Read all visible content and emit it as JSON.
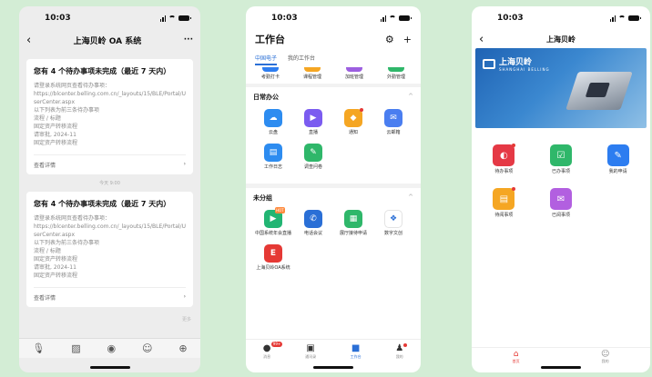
{
  "status": {
    "time": "10:03"
  },
  "chat": {
    "title": "上海贝岭 OA 系统",
    "more": "···",
    "messages": [
      {
        "title": "您有 4 个待办事项未完成（最近 7 天内）",
        "lines": [
          "请登录系统网页查看待办事项：",
          "https://blcenter.belling.com.cn/_layouts/15/BLE/Portal/UserCenter.aspx",
          "以下列表为前三条待办事项",
          "流程 / 标题",
          "固定资产转移流程",
          "请审批, 2024-11",
          "固定资产转移流程"
        ],
        "detail": "查看详情"
      },
      {
        "title": "您有 4 个待办事项未完成（最近 7 天内）",
        "lines": [
          "请登录系统网页查看待办事项：",
          "https://blcenter.belling.com.cn/_layouts/15/BLE/Portal/UserCenter.aspx",
          "以下列表为前三条待办事项",
          "流程 / 标题",
          "固定资产转移流程",
          "请审批, 2024-11",
          "固定资产转移流程"
        ],
        "detail": "查看详情"
      }
    ],
    "time_divider": "今天 9:00",
    "more_label": "更多",
    "input_icons": [
      "mic-icon",
      "image-icon",
      "camera-icon",
      "emoji-icon",
      "plus-icon"
    ]
  },
  "workbench": {
    "title": "工作台",
    "tabs": [
      "中国电子",
      "我的工作台"
    ],
    "top_apps": [
      {
        "label": "考勤打卡",
        "color": "#2d7df0"
      },
      {
        "label": "课程管理",
        "color": "#f5a623"
      },
      {
        "label": "加班管理",
        "color": "#9c5fe0"
      },
      {
        "label": "外勤管理",
        "color": "#2fb76a"
      }
    ],
    "section1": {
      "title": "日常办公",
      "collapse": "^",
      "apps": [
        {
          "label": "云盘",
          "color": "#2d8cf0",
          "icon": "☁",
          "dot": false
        },
        {
          "label": "直播",
          "color": "#7b5cf0",
          "icon": "▶",
          "dot": false
        },
        {
          "label": "通知",
          "color": "#f5a623",
          "icon": "◆",
          "dot": true
        },
        {
          "label": "云邮箱",
          "color": "#4a7ef0",
          "icon": "✉",
          "dot": false
        },
        {
          "label": "工作日志",
          "color": "#2d8cf0",
          "icon": "▤",
          "dot": false
        },
        {
          "label": "调查问卷",
          "color": "#2fb76a",
          "icon": "✎",
          "dot": false
        }
      ]
    },
    "section2": {
      "title": "未分组",
      "collapse": "^",
      "apps": [
        {
          "label": "中国系统年会直播",
          "color": "#22b573",
          "icon": "▶",
          "hot": "HOT"
        },
        {
          "label": "电话会议",
          "color": "#2a6fd6",
          "icon": "✆",
          "hot": ""
        },
        {
          "label": "展厅接待申请",
          "color": "#2fb76a",
          "icon": "▦",
          "hot": ""
        },
        {
          "label": "数字文创",
          "color": "#ffffff",
          "icon": "❖",
          "hot": ""
        },
        {
          "label": "上海贝岭OA系统",
          "color": "#e53935",
          "icon": "E",
          "hot": ""
        }
      ]
    },
    "bottom_tabs": [
      {
        "label": "消息",
        "icon": "●",
        "badge": "99+"
      },
      {
        "label": "通讯录",
        "icon": "▣",
        "badge": ""
      },
      {
        "label": "工作台",
        "icon": "■",
        "badge": ""
      },
      {
        "label": "我的",
        "icon": "♟",
        "badge": "dot"
      }
    ]
  },
  "oa": {
    "title": "上海贝岭",
    "brand_cn": "上海贝岭",
    "brand_en": "SHANGHAI BELLING",
    "apps": [
      {
        "label": "待办事项",
        "color": "#e53945",
        "icon": "◐",
        "dot": true
      },
      {
        "label": "已办事项",
        "color": "#2fb76a",
        "icon": "☑",
        "dot": false
      },
      {
        "label": "我的申请",
        "color": "#2d7df0",
        "icon": "✎",
        "dot": false
      },
      {
        "label": "待阅事项",
        "color": "#f5a623",
        "icon": "▤",
        "dot": true
      },
      {
        "label": "已阅事项",
        "color": "#b25fe0",
        "icon": "✉",
        "dot": false
      }
    ],
    "bottom_tabs": [
      {
        "label": "首页",
        "icon": "⌂"
      },
      {
        "label": "我的",
        "icon": "☺"
      }
    ]
  }
}
